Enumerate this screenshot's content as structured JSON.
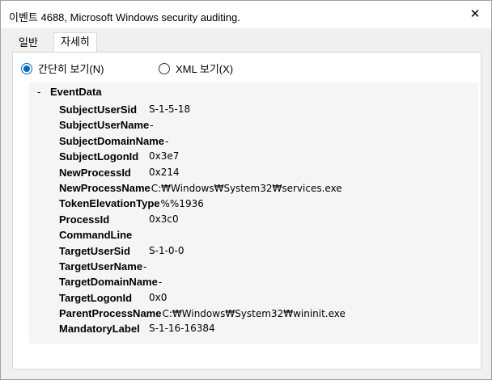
{
  "window": {
    "title": "이벤트 4688, Microsoft Windows security auditing.",
    "close_glyph": "✕"
  },
  "tabs": [
    {
      "label": "일반",
      "active": false
    },
    {
      "label": "자세히",
      "active": true
    }
  ],
  "view_options": {
    "friendly": {
      "label": "간단히 보기(N)",
      "checked": true
    },
    "xml": {
      "label": "XML 보기(X)",
      "checked": false
    }
  },
  "event_data": {
    "header_dash": "-",
    "header": "EventData",
    "rows": [
      {
        "key": "SubjectUserSid",
        "value": "S-1-5-18",
        "aligned": true
      },
      {
        "key": "SubjectUserName",
        "value": "-",
        "aligned": false
      },
      {
        "key": "SubjectDomainName",
        "value": "-",
        "aligned": false
      },
      {
        "key": "SubjectLogonId",
        "value": "0x3e7",
        "aligned": true
      },
      {
        "key": "NewProcessId",
        "value": "0x214",
        "aligned": true
      },
      {
        "key": "NewProcessName",
        "value": "C:₩Windows₩System32₩services.exe",
        "aligned": false
      },
      {
        "key": "TokenElevationType",
        "value": "%%1936",
        "aligned": false
      },
      {
        "key": "ProcessId",
        "value": "0x3c0",
        "aligned": true
      },
      {
        "key": "CommandLine",
        "value": "",
        "aligned": true
      },
      {
        "key": "TargetUserSid",
        "value": "S-1-0-0",
        "aligned": true
      },
      {
        "key": "TargetUserName",
        "value": "-",
        "aligned": false
      },
      {
        "key": "TargetDomainName",
        "value": "-",
        "aligned": false
      },
      {
        "key": "TargetLogonId",
        "value": "0x0",
        "aligned": true
      },
      {
        "key": "ParentProcessName",
        "value": "C:₩Windows₩System32₩wininit.exe",
        "aligned": false
      },
      {
        "key": "MandatoryLabel",
        "value": "S-1-16-16384",
        "aligned": true
      }
    ]
  },
  "colors": {
    "accent": "#0067c0",
    "window_bg": "#f0f0f0",
    "panel_bg": "#ffffff",
    "content_bg": "#f5f5f5"
  }
}
